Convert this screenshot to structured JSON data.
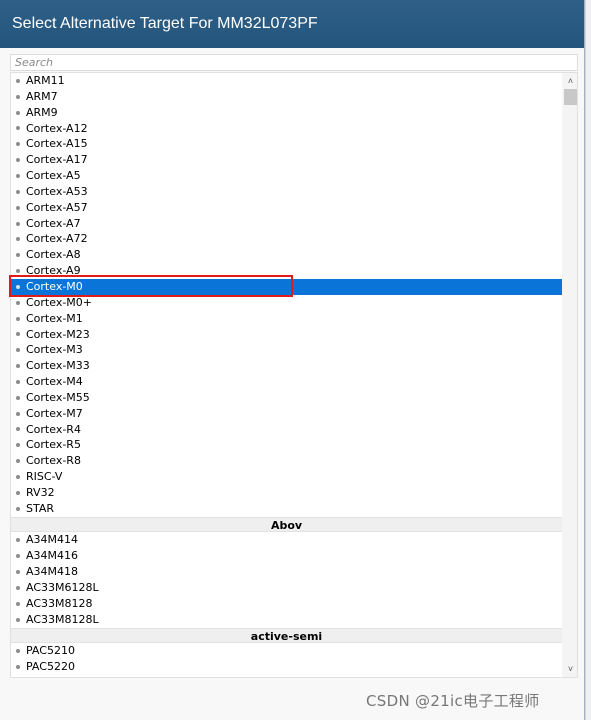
{
  "dialog": {
    "title": "Select Alternative Target For MM32L073PF",
    "search_placeholder": "Search"
  },
  "list": {
    "groups": [
      {
        "header": "",
        "items": [
          "ARM11",
          "ARM7",
          "ARM9",
          "Cortex-A12",
          "Cortex-A15",
          "Cortex-A17",
          "Cortex-A5",
          "Cortex-A53",
          "Cortex-A57",
          "Cortex-A7",
          "Cortex-A72",
          "Cortex-A8",
          "Cortex-A9",
          "Cortex-M0",
          "Cortex-M0+",
          "Cortex-M1",
          "Cortex-M23",
          "Cortex-M3",
          "Cortex-M33",
          "Cortex-M4",
          "Cortex-M55",
          "Cortex-M7",
          "Cortex-R4",
          "Cortex-R5",
          "Cortex-R8",
          "RISC-V",
          "RV32",
          "STAR"
        ]
      },
      {
        "header": "Abov",
        "items": [
          "A34M414",
          "A34M416",
          "A34M418",
          "AC33M6128L",
          "AC33M8128",
          "AC33M8128L"
        ]
      },
      {
        "header": "active-semi",
        "items": [
          "PAC5210",
          "PAC5220"
        ]
      }
    ],
    "selected": "Cortex-M0"
  },
  "icons": {
    "scroll_up": "˄",
    "scroll_down": "˅"
  },
  "watermark": "CSDN @21ic电子工程师",
  "colors": {
    "titlebar": "#2a5a82",
    "selection": "#0a74d8",
    "highlight_box": "#e01b1b"
  }
}
